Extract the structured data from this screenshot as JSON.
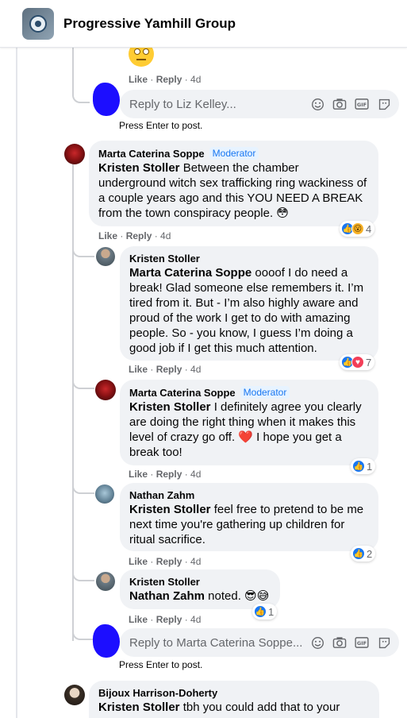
{
  "group": {
    "name": "Progressive Yamhill Group"
  },
  "top_comment": {
    "actions": {
      "like": "Like",
      "reply": "Reply",
      "time": "4d"
    }
  },
  "reply_box_1": {
    "placeholder": "Reply to Liz Kelley...",
    "hint": "Press Enter to post."
  },
  "comments": [
    {
      "author": "Marta Caterina Soppe",
      "badge": "Moderator",
      "mention": "Kristen Stoller",
      "text": " Between the chamber underground witch sex trafficking ring wackiness of a couple years ago and this YOU NEED A BREAK from the town conspiracy people. 😳",
      "reactions": "4",
      "actions": {
        "like": "Like",
        "reply": "Reply",
        "time": "4d"
      }
    },
    {
      "author": "Kristen Stoller",
      "mention": "Marta Caterina Soppe",
      "text": " oooof I do need a break! Glad someone else remembers it. I’m tired from it. But - I’m also highly aware and proud of the work I get to do with amazing people. So - you know, I guess I’m doing a good job if I get this much attention.",
      "reactions": "7",
      "actions": {
        "like": "Like",
        "reply": "Reply",
        "time": "4d"
      }
    },
    {
      "author": "Marta Caterina Soppe",
      "badge": "Moderator",
      "mention": "Kristen Stoller",
      "text": " I definitely agree you clearly are doing the right thing when it makes this level of crazy go off. ❤️ I hope you get a break too!",
      "reactions": "1",
      "actions": {
        "like": "Like",
        "reply": "Reply",
        "time": "4d"
      }
    },
    {
      "author": "Nathan Zahm",
      "mention": "Kristen Stoller",
      "text": " feel free to pretend to be me next time you're gathering up children for ritual sacrifice.",
      "reactions": "2",
      "actions": {
        "like": "Like",
        "reply": "Reply",
        "time": "4d"
      }
    },
    {
      "author": "Kristen Stoller",
      "mention": "Nathan Zahm",
      "text": " noted. 😎😅",
      "reactions": "1",
      "actions": {
        "like": "Like",
        "reply": "Reply",
        "time": "4d"
      }
    }
  ],
  "reply_box_2": {
    "placeholder": "Reply to Marta Caterina Soppe...",
    "hint": "Press Enter to post."
  },
  "last_comment": {
    "author": "Bijoux Harrison-Doherty",
    "mention": "Kristen Stoller",
    "text": " tbh you could add that to your"
  },
  "icons": [
    "emoji-icon",
    "camera-icon",
    "gif-icon",
    "sticker-icon"
  ],
  "colors": {
    "accent": "#1877f2",
    "bubble": "#f0f2f5",
    "moderator_bg": "#e7f3ff"
  }
}
